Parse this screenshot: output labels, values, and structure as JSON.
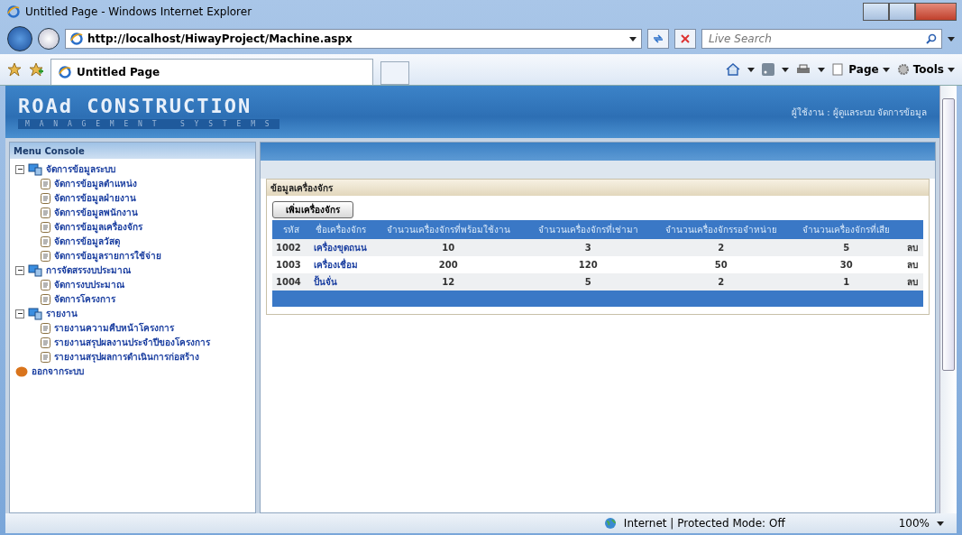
{
  "window": {
    "title": "Untitled Page - Windows Internet Explorer"
  },
  "address_bar": {
    "url": "http://localhost/HiwayProject/Machine.aspx"
  },
  "search": {
    "placeholder": "Live Search"
  },
  "tabs": [
    {
      "label": "Untitled Page",
      "selected": true
    }
  ],
  "command_bar": {
    "items": [
      "Page",
      "Tools"
    ]
  },
  "header": {
    "logo_title": "ROAd CONSTRUCTION",
    "logo_subtitle": "M A N A G E M E N T   S Y S T E M S",
    "user": "ผู้ใช้งาน : ผู้ดูแลระบบ จัดการข้อมูล"
  },
  "sidebar": {
    "title": "Menu Console",
    "items": [
      {
        "label": "จัดการข้อมูลระบบ",
        "expanded": true,
        "children": [
          {
            "label": "จัดการข้อมูลตำแหน่ง"
          },
          {
            "label": "จัดการข้อมูลฝ่ายงาน"
          },
          {
            "label": "จัดการข้อมูลพนักงาน"
          },
          {
            "label": "จัดการข้อมูลเครื่องจักร"
          },
          {
            "label": "จัดการข้อมูลวัสดุ"
          },
          {
            "label": "จัดการข้อมูลรายการใช้จ่าย"
          }
        ]
      },
      {
        "label": "การจัดสรรงบประมาณ",
        "expanded": true,
        "children": [
          {
            "label": "จัดการงบประมาณ"
          },
          {
            "label": "จัดการโครงการ"
          }
        ]
      },
      {
        "label": "รายงาน",
        "expanded": true,
        "children": [
          {
            "label": "รายงานความคืบหน้าโครงการ"
          },
          {
            "label": "รายงานสรุปผลงานประจำปีของโครงการ"
          },
          {
            "label": "รายงานสรุปผลการดำเนินการก่อสร้าง"
          }
        ]
      }
    ],
    "logout": "ออกจากระบบ"
  },
  "panel": {
    "title": "ข้อมูลเครื่องจักร",
    "add_button": "เพิ่มเครื่องจักร",
    "table": {
      "columns": [
        "รหัส",
        "ชื่อเครื่องจักร",
        "จำนวนเครื่องจักรที่พร้อมใช้งาน",
        "จำนวนเครื่องจักรที่เช่ามา",
        "จำนวนเครื่องจักรรอจำหน่าย",
        "จำนวนเครื่องจักรที่เสีย"
      ],
      "rows": [
        {
          "cells": [
            "1002",
            "เครื่องขุดถนน",
            "10",
            "3",
            "2",
            "5"
          ],
          "action": "ลบ"
        },
        {
          "cells": [
            "1003",
            "เครื่องเชื่อม",
            "200",
            "120",
            "50",
            "30"
          ],
          "action": "ลบ"
        },
        {
          "cells": [
            "1004",
            "ปั้นจั่น",
            "12",
            "5",
            "2",
            "1"
          ],
          "action": "ลบ"
        }
      ]
    }
  },
  "status_bar": {
    "zone": "Internet | Protected Mode: Off",
    "zoom": "100%"
  }
}
